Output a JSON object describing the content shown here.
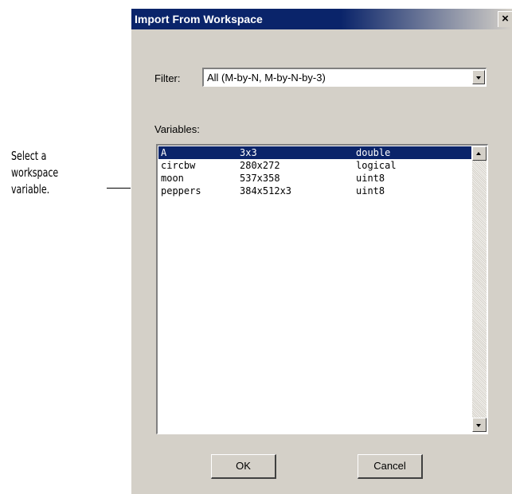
{
  "callout": {
    "lines": [
      "Select a",
      "workspace",
      "variable."
    ]
  },
  "dialog": {
    "title": "Import From Workspace",
    "close_glyph": "×",
    "filter": {
      "label": "Filter:",
      "value": "All (M-by-N, M-by-N-by-3)"
    },
    "variables": {
      "label": "Variables:",
      "rows": [
        {
          "name": "A",
          "size": "3x3",
          "class": "double",
          "selected": true
        },
        {
          "name": "circbw",
          "size": "280x272",
          "class": "logical",
          "selected": false
        },
        {
          "name": "moon",
          "size": "537x358",
          "class": "uint8",
          "selected": false
        },
        {
          "name": "peppers",
          "size": "384x512x3",
          "class": "uint8",
          "selected": false
        }
      ]
    },
    "buttons": {
      "ok": "OK",
      "cancel": "Cancel"
    }
  },
  "icons": {
    "close": "close-icon",
    "dropdown": "chevron-down-icon",
    "scroll_up": "scroll-up-icon",
    "scroll_down": "scroll-down-icon"
  },
  "colors": {
    "titlebar": "#0a246a",
    "selection": "#0a246a",
    "dialog_face": "#d4d0c8"
  }
}
